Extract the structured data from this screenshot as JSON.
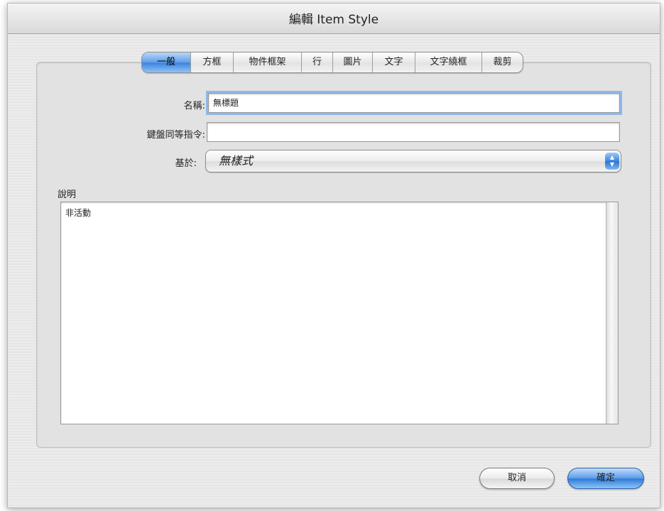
{
  "window": {
    "title": "編輯 Item Style"
  },
  "tabs": [
    {
      "label": "一般",
      "active": true
    },
    {
      "label": "方框",
      "active": false
    },
    {
      "label": "物件框架",
      "active": false
    },
    {
      "label": "行",
      "active": false
    },
    {
      "label": "圖片",
      "active": false
    },
    {
      "label": "文字",
      "active": false
    },
    {
      "label": "文字繞框",
      "active": false
    },
    {
      "label": "裁剪",
      "active": false
    }
  ],
  "form": {
    "name_label": "名稱:",
    "name_value": "無標題",
    "shortcut_label": "鍵盤同等指令:",
    "shortcut_value": "",
    "based_on_label": "基於:",
    "based_on_value": "無樣式"
  },
  "description": {
    "label": "說明",
    "text": "非活動"
  },
  "buttons": {
    "cancel_label": "取消",
    "ok_label": "確定"
  },
  "colors": {
    "accent": "#3b82df",
    "focus_ring": "#8fb8ea"
  }
}
